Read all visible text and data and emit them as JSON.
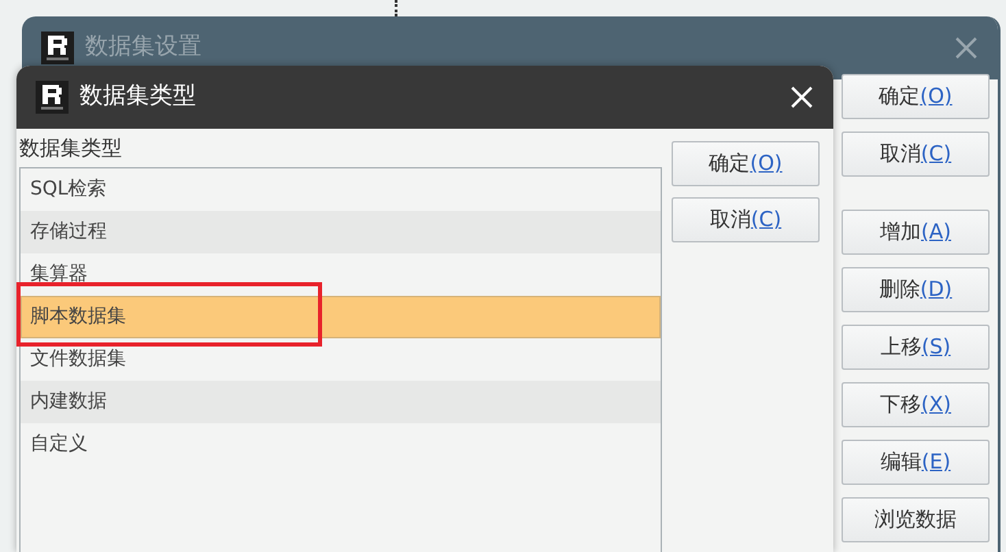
{
  "outer_dialog": {
    "title": "数据集设置",
    "button_groups": [
      [
        {
          "label": "确定",
          "mnemonic": "(O)"
        },
        {
          "label": "取消",
          "mnemonic": "(C)"
        }
      ],
      [
        {
          "label": "增加",
          "mnemonic": "(A)"
        },
        {
          "label": "删除",
          "mnemonic": "(D)"
        },
        {
          "label": "上移",
          "mnemonic": "(S)"
        },
        {
          "label": "下移",
          "mnemonic": "(X)"
        },
        {
          "label": "编辑",
          "mnemonic": "(E)"
        },
        {
          "label": "浏览数据"
        }
      ]
    ]
  },
  "inner_dialog": {
    "title": "数据集类型",
    "list_label": "数据集类型",
    "items": [
      {
        "label": "SQL检索",
        "selected": false
      },
      {
        "label": "存储过程",
        "selected": false
      },
      {
        "label": "集算器",
        "selected": false
      },
      {
        "label": "脚本数据集",
        "selected": true,
        "boxed": true
      },
      {
        "label": "文件数据集",
        "selected": false
      },
      {
        "label": "内建数据",
        "selected": false
      },
      {
        "label": "自定义",
        "selected": false
      }
    ],
    "buttons": [
      {
        "label": "确定",
        "mnemonic": "(O)"
      },
      {
        "label": "取消",
        "mnemonic": "(C)"
      }
    ]
  }
}
